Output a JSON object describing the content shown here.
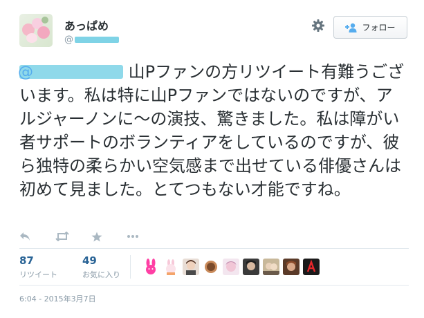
{
  "user": {
    "display_name": "あっぱめ",
    "screen_name_prefix": "@"
  },
  "follow_button": {
    "label": "フォロー"
  },
  "tweet": {
    "text_after_mention": " 山Pファンの方リツイート有難うございます。私は特に山Pファンではないのですが、アルジャーノンに〜の演技、驚きました。私は障がい者サポートのボランティアをしているのですが、彼ら独特の柔らかい空気感まで出せている俳優さんは初めて見ました。とてつもない才能ですね。"
  },
  "stats": {
    "retweets": {
      "count": "87",
      "label": "リツイート"
    },
    "favorites": {
      "count": "49",
      "label": "お気に入り"
    }
  },
  "timestamp": "6:04 - 2015年3月7日",
  "icons": {
    "reply": "reply-icon",
    "retweet": "retweet-icon",
    "favorite": "star-icon",
    "more": "more-icon",
    "settings": "gear-icon",
    "follow": "follow-person-plus-icon"
  },
  "colors": {
    "link": "#2a6496",
    "muted": "#8899a6",
    "text": "#292f33",
    "redaction": "#8fd9ea"
  }
}
